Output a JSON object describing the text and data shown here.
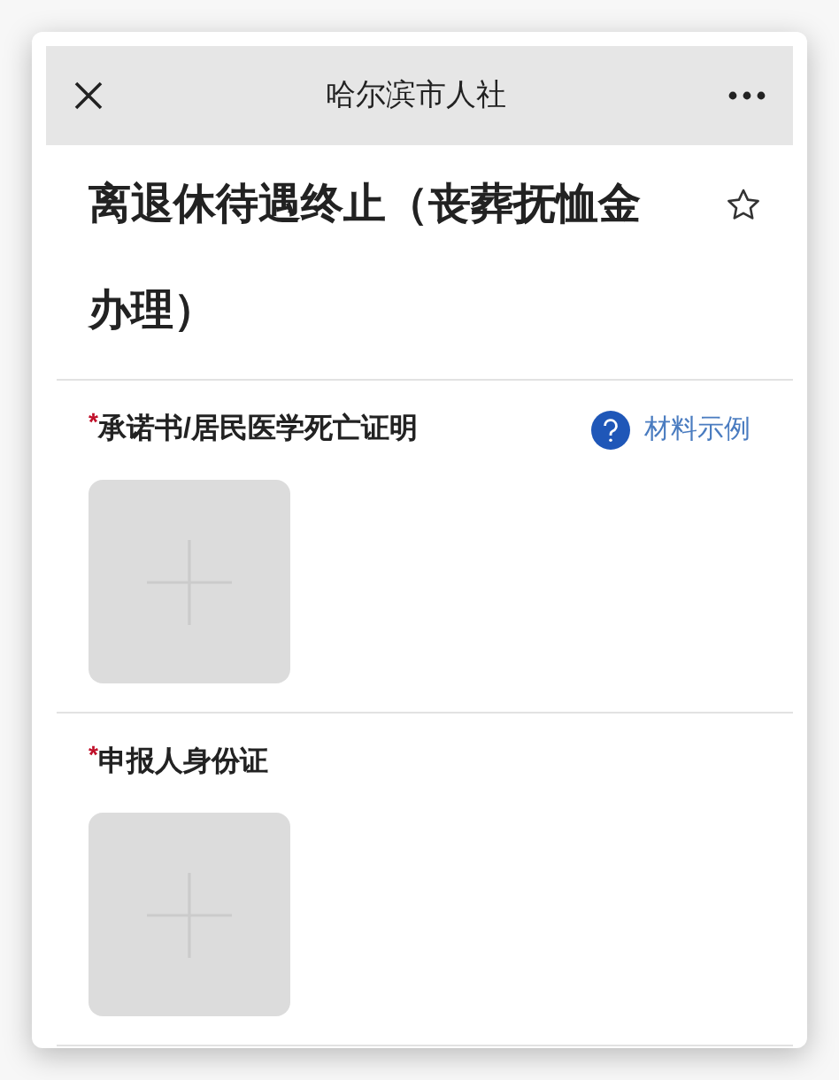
{
  "header": {
    "title": "哈尔滨市人社"
  },
  "page": {
    "title": "离退休待遇终止（丧葬抚恤金",
    "title_line_2": "办理）",
    "favorite": false
  },
  "sections": [
    {
      "label": "承诺书/居民医学死亡证明",
      "required": true,
      "required_mark": "*",
      "sample_link": "材料示例"
    },
    {
      "label": "申报人身份证",
      "required": true,
      "required_mark": "*"
    }
  ]
}
